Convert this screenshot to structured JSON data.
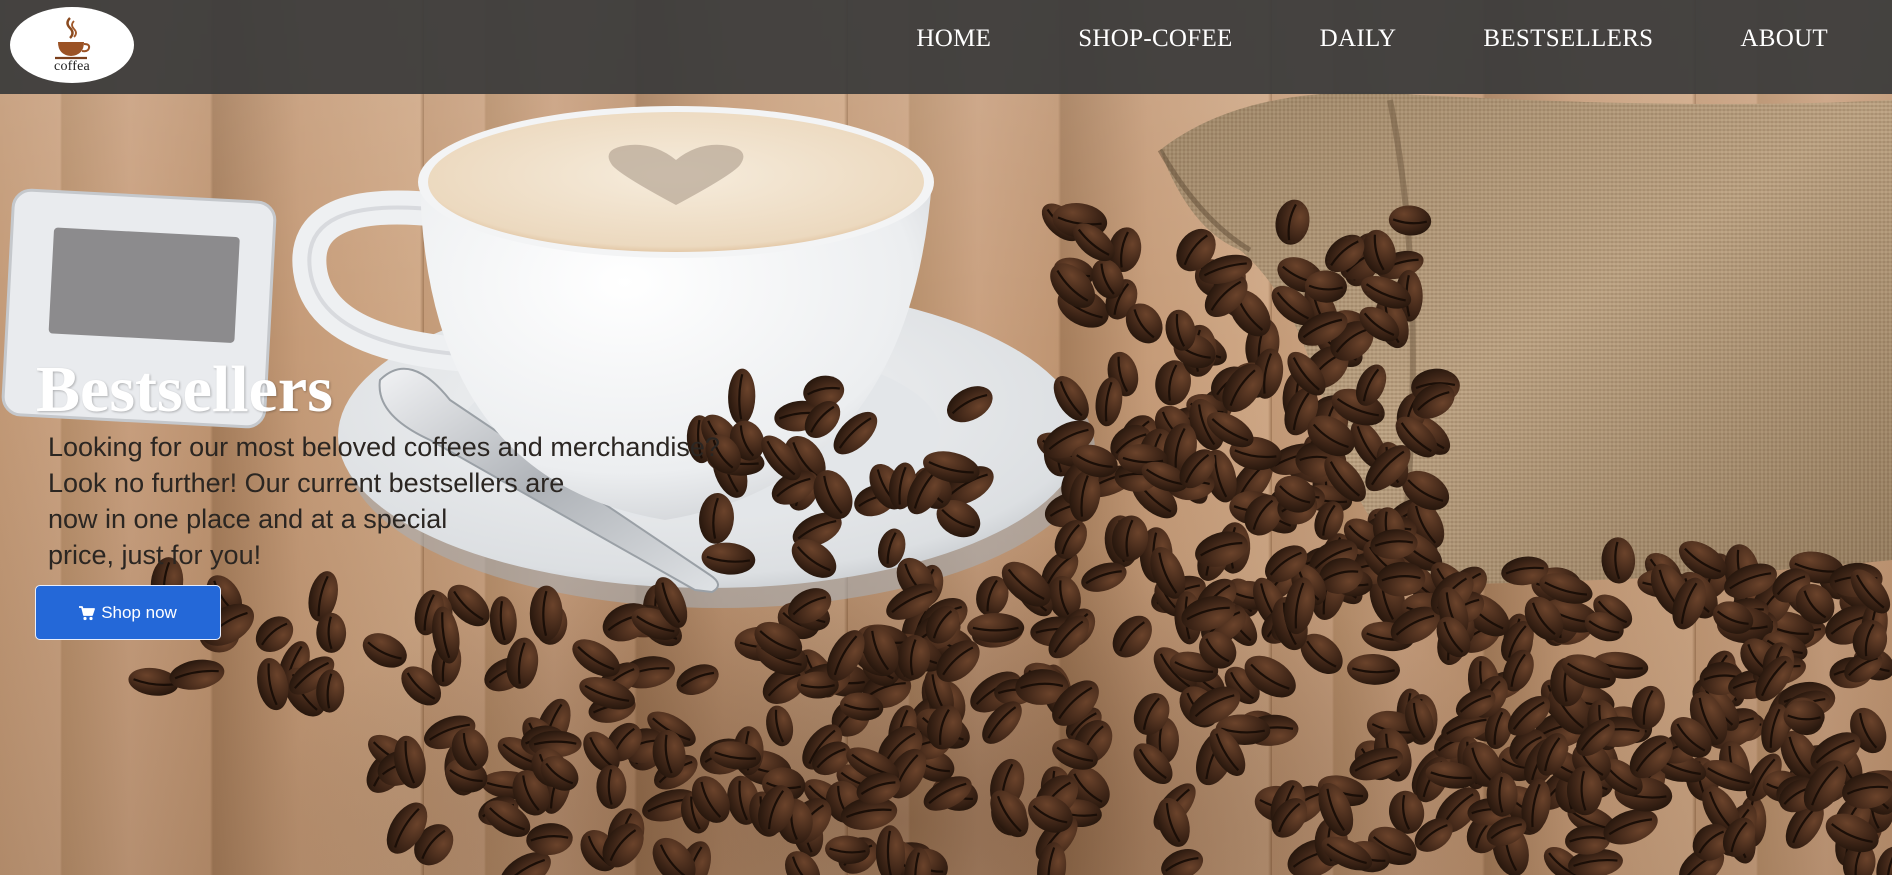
{
  "brand": {
    "logo_icon": "coffee-cup-icon",
    "logo_text": "coffea"
  },
  "nav": {
    "items": [
      {
        "label": "HOME"
      },
      {
        "label": "SHOP-COFEE"
      },
      {
        "label": "DAILY"
      },
      {
        "label": "BESTSELLERS"
      },
      {
        "label": "ABOUT"
      }
    ]
  },
  "hero": {
    "title": "Bestsellers",
    "lines": [
      "Looking for our most beloved coffees and merchandise?",
      "Look no further! Our current bestsellers are",
      "now in one place and at a special",
      "price, just for you!"
    ],
    "cta_icon": "cart-icon",
    "cta_label": "Shop now"
  },
  "colors": {
    "navbar": "#3a3a3a",
    "cta": "#2468d8",
    "wood": "#c39a77",
    "bean": "#3d2416"
  }
}
